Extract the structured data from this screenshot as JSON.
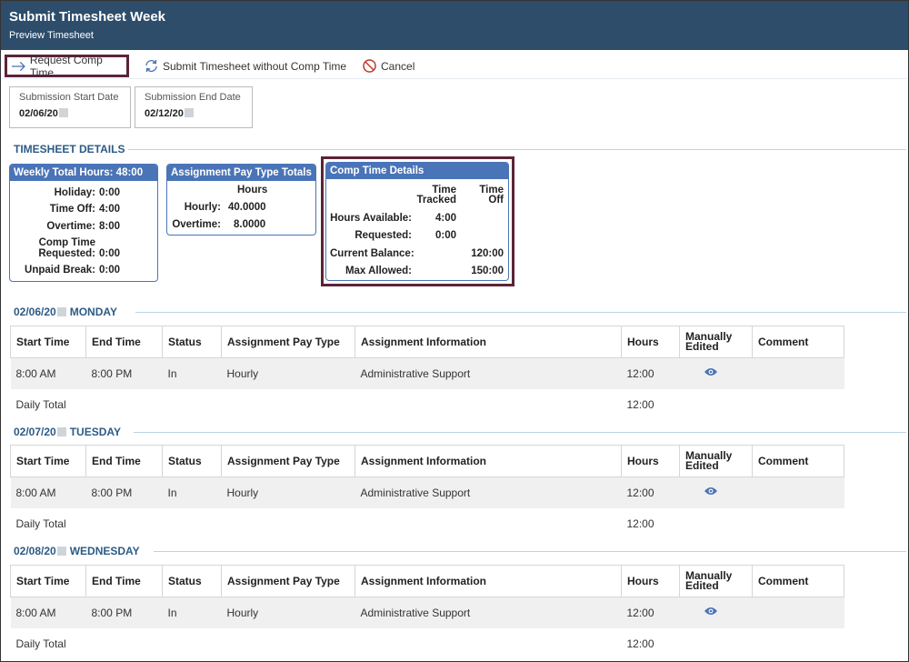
{
  "header": {
    "title": "Submit Timesheet Week",
    "subtitle": "Preview Timesheet"
  },
  "toolbar": {
    "request_comp": "Request Comp Time",
    "submit_without": "Submit Timesheet without Comp Time",
    "cancel": "Cancel"
  },
  "dates": {
    "start_label": "Submission Start Date",
    "start_value": "02/06/20",
    "end_label": "Submission End Date",
    "end_value": "02/12/20"
  },
  "details_heading": "TIMESHEET DETAILS",
  "weekly": {
    "title": "Weekly Total Hours: 48:00",
    "holiday_label": "Holiday:",
    "holiday_value": "0:00",
    "timeoff_label": "Time Off:",
    "timeoff_value": "4:00",
    "overtime_label": "Overtime:",
    "overtime_value": "8:00",
    "comp_label_1": "Comp Time",
    "comp_label_2": "Requested:",
    "comp_value": "0:00",
    "unpaid_label": "Unpaid Break:",
    "unpaid_value": "0:00"
  },
  "paytype": {
    "title": "Assignment Pay Type Totals",
    "col": "Hours",
    "hourly_label": "Hourly:",
    "hourly_value": "40.0000",
    "overtime_label": "Overtime:",
    "overtime_value": "8.0000"
  },
  "comp": {
    "title": "Comp Time Details",
    "col1_a": "Time",
    "col1_b": "Tracked",
    "col2_a": "Time",
    "col2_b": "Off",
    "avail_label": "Hours Available:",
    "avail_value": "4:00",
    "req_label": "Requested:",
    "req_value": "0:00",
    "bal_label": "Current Balance:",
    "bal_value": "120:00",
    "max_label": "Max Allowed:",
    "max_value": "150:00"
  },
  "columns": {
    "start": "Start Time",
    "end": "End Time",
    "status": "Status",
    "paytype": "Assignment Pay Type",
    "info": "Assignment Information",
    "hours": "Hours",
    "manual_a": "Manually",
    "manual_b": "Edited",
    "comment": "Comment"
  },
  "days": [
    {
      "date": "02/06/20",
      "name": "MONDAY",
      "start": "8:00 AM",
      "end": "8:00 PM",
      "status": "In",
      "paytype": "Hourly",
      "info": "Administrative Support",
      "hours": "12:00",
      "total_label": "Daily Total",
      "total": "12:00"
    },
    {
      "date": "02/07/20",
      "name": "TUESDAY",
      "start": "8:00 AM",
      "end": "8:00 PM",
      "status": "In",
      "paytype": "Hourly",
      "info": "Administrative Support",
      "hours": "12:00",
      "total_label": "Daily Total",
      "total": "12:00"
    },
    {
      "date": "02/08/20",
      "name": "WEDNESDAY",
      "start": "8:00 AM",
      "end": "8:00 PM",
      "status": "In",
      "paytype": "Hourly",
      "info": "Administrative Support",
      "hours": "12:00",
      "total_label": "Daily Total",
      "total": "12:00"
    }
  ],
  "colors": {
    "header_bg": "#2d4d6b",
    "card_blue": "#4a74b8",
    "highlight": "#5b2437",
    "section_text": "#2d5b86"
  }
}
